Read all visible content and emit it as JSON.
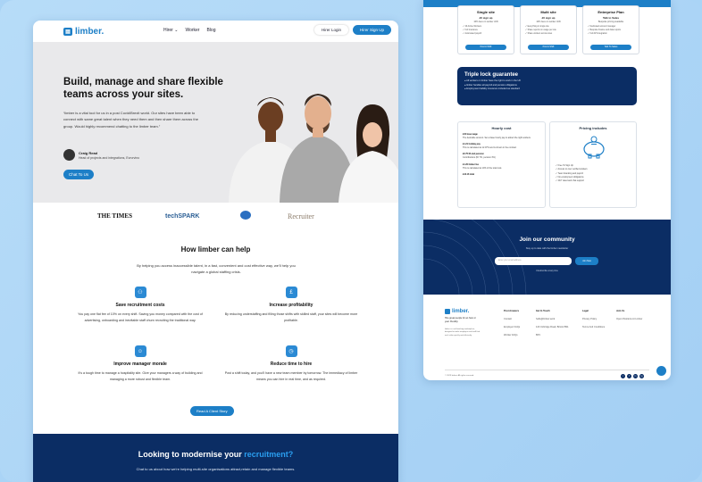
{
  "colors": {
    "brand": "#1d7fc7",
    "navy": "#0b2d64",
    "accent": "#2a9ef0",
    "background": "#aad4f6"
  },
  "left": {
    "logo": "limber.",
    "nav": {
      "hirer": "Hirer",
      "worker": "Worker",
      "blog": "Blog",
      "login": "Hirer Login",
      "signup": "Hirer Sign Up"
    },
    "hero": {
      "title": "Build, manage and share flexible teams across your sites.",
      "quote": "“limber is a vital tool for us in a post Covid/Brexit world. Our sites have been able to connect with same great talent when they need them and then share them across the group. Would highly recommend chatting to the limber team.”",
      "person_name": "Craig Read",
      "person_role": "Head of projects and integrations, Evrorvino",
      "cta": "Chat To Us"
    },
    "logos": {
      "times": "THE TIMES",
      "techspark": "techSPARK",
      "recruiter": "Recruiter"
    },
    "help": {
      "title": "How limber can help",
      "subtitle": "By helping you access inaccessible talent, in a fast, convenient and cost effective way, we'll help you navigate a global staffing crisis.",
      "features": [
        {
          "title": "Save recruitment costs",
          "desc": "You pay one flat fee of 10% on every shift. Saving you money compared with the cost of advertising, onboarding and inevitable staff churn recruiting the traditional way."
        },
        {
          "title": "Increase profitability",
          "desc": "By reducing understaffing and filling those shifts with skilled staff, your sites will become more profitable."
        },
        {
          "title": "Improve manager morale",
          "desc": "It's a tough time to manage a hospitality site. Give your managers a way of building and managing a more robust and flexible team."
        },
        {
          "title": "Reduce time to hire",
          "desc": "Post a shift today, and you'll have a new team member by tomorrow. The immediacy of limber means you can hire in real time, and as required."
        }
      ],
      "read": "Read A Client Story"
    },
    "footer_cta": {
      "title": "Looking to modernise your ",
      "title_accent": "recruitment?",
      "desc": "Chat to us about how we're helping multi-site organisations attract,retain and manage flexible teams."
    }
  },
  "right": {
    "plans": [
      {
        "name": "Single site",
        "price": "£0 sign up",
        "sub": "10% fees on worker shift",
        "items": [
          "20 Active Workers",
          "Full insurance",
          "Automated payroll"
        ],
        "button": "Post A Shift"
      },
      {
        "name": "Multi site",
        "price": "£0 sign up",
        "sub": "10% fees on worker shift",
        "items": [
          "Everything in single site",
          "Share reports on usage per site",
          "Share workers across sites"
        ],
        "button": "Post A Shift"
      },
      {
        "name": "Enterprise Plan",
        "price": "Talk to Sales",
        "sub": "Bespoke pricing available",
        "items": [
          "Dedicated account manager",
          "Bespoke finance and data reports",
          "Full API integration"
        ],
        "button": "Talk To Sales"
      }
    ],
    "triple": {
      "title": "Triple lock guarantee",
      "items": [
        "All workers on limber have the right to work in the UK",
        "limber handles all payroll and pension obligations",
        "Employment liability insurance included as standard"
      ]
    },
    "hourly": {
      "title": "Hourly cost",
      "lines": [
        {
          "b": "£10 base wage",
          "t": "The desirable amount. Set a base hourly pay to attract the right workers."
        },
        {
          "b": "£1.21 holiday pay",
          "t": "This is calculated at 12.07% and is shown in the contract"
        },
        {
          "b": "£0.75 NI and pension",
          "t": "Contributions (NI 7%, pension 3%)"
        },
        {
          "b": "£1.20 limber fee",
          "t": "This is calculated at 10% of the total cost."
        },
        {
          "b": "£13.16 total",
          "t": ""
        }
      ]
    },
    "pricing": {
      "title": "Pricing includes",
      "items": [
        "Free To Sign Up",
        "Access to over verified workers",
        "Team branding and payroll",
        "No employment obligations",
        "24/7 rated and chat support"
      ]
    },
    "community": {
      "title": "Join our community",
      "sub": "Stay up to date with the limber newsletter",
      "placeholder": "Enter your email address",
      "button": "Join Now",
      "unsub": "Unsubscribe at any time"
    },
    "footer": {
      "logo": "limber.",
      "tag": "Hire great people for an hour or year. Flexibly.",
      "desc": "limber is a self-working marketplace, designed to make employers and staff find each other quickly and efficiently.",
      "cols": [
        {
          "h": "Post Answers",
          "items": [
            "Contact",
            "Employer FAQs",
            "Worker FAQs"
          ]
        },
        {
          "h": "Get In Touch",
          "items": [
            "hello@limber.work",
            "123 Uxbridge Road, Bristol BS1",
            "BP1"
          ]
        },
        {
          "h": "Legal",
          "items": [
            "Privacy Policy",
            "Terms And Conditions"
          ]
        },
        {
          "h": "Join Us",
          "items": [
            "Open Positions At Limber"
          ]
        }
      ],
      "copy": "© 2023 limber. All rights reserved.",
      "social": [
        "t",
        "f",
        "in",
        "ig"
      ]
    }
  }
}
